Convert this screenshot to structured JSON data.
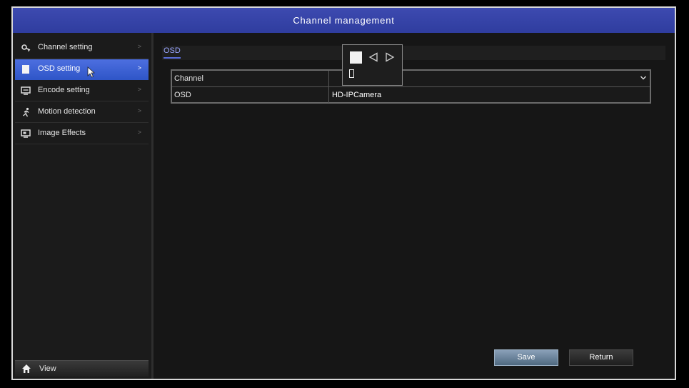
{
  "window": {
    "title": "Channel management"
  },
  "sidebar": {
    "items": [
      {
        "label": "Channel setting",
        "icon": "gear-key-icon",
        "chevron": ">",
        "active": false
      },
      {
        "label": "OSD setting",
        "icon": "document-icon",
        "chevron": ">",
        "active": true
      },
      {
        "label": "Encode setting",
        "icon": "encode-icon",
        "chevron": ">",
        "active": false
      },
      {
        "label": "Motion detection",
        "icon": "running-man-icon",
        "chevron": ">",
        "active": false
      },
      {
        "label": "Image Effects",
        "icon": "image-effects-icon",
        "chevron": ">",
        "active": false
      }
    ],
    "view_button": {
      "label": "View",
      "icon": "home-icon"
    }
  },
  "content": {
    "tabs": [
      {
        "label": "OSD",
        "active": true
      }
    ],
    "form": {
      "channel_label": "Channel",
      "channel_value": "",
      "osd_label": "OSD",
      "osd_value": "HD-IPCamera"
    },
    "keypad_popup": {
      "icons": [
        "square-key-icon",
        "left-arrow-icon",
        "right-arrow-icon",
        "text-caret-icon"
      ]
    },
    "buttons": {
      "save": "Save",
      "return": "Return"
    }
  },
  "colors": {
    "title_bar": "#2f3d9f",
    "active_item": "#3b62d6",
    "tab_accent": "#9aa6ff",
    "save_button": "#6a8298"
  }
}
